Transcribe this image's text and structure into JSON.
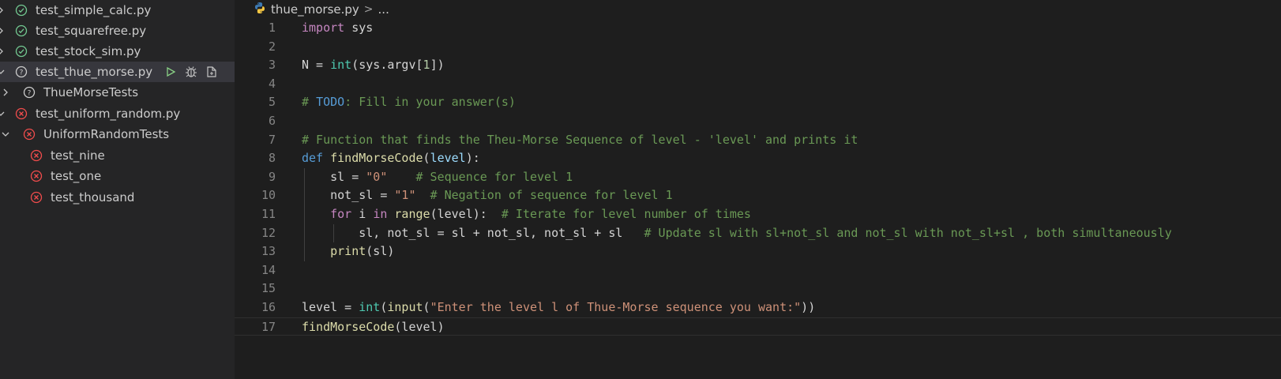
{
  "explorer": {
    "items": [
      {
        "label": "test_simple_calc.py",
        "status": "passed",
        "expanded": false
      },
      {
        "label": "test_squarefree.py",
        "status": "passed",
        "expanded": false
      },
      {
        "label": "test_stock_sim.py",
        "status": "passed",
        "expanded": false
      },
      {
        "label": "test_thue_morse.py",
        "status": "unknown",
        "expanded": true,
        "selected": true
      },
      {
        "label": "ThueMorseTests",
        "status": "unknown",
        "expanded": false
      },
      {
        "label": "test_uniform_random.py",
        "status": "failed",
        "expanded": true
      },
      {
        "label": "UniformRandomTests",
        "status": "failed",
        "expanded": true
      },
      {
        "label": "test_nine",
        "status": "failed"
      },
      {
        "label": "test_one",
        "status": "failed"
      },
      {
        "label": "test_thousand",
        "status": "failed"
      }
    ],
    "row_actions": [
      "run-icon",
      "debug-icon",
      "open-file-icon"
    ]
  },
  "editor": {
    "breadcrumb": {
      "file": "thue_morse.py",
      "separator": ">",
      "rest": "..."
    },
    "lines": [
      {
        "num": "1",
        "tokens": [
          [
            "kw",
            "import"
          ],
          [
            "p",
            " sys"
          ]
        ]
      },
      {
        "num": "2",
        "tokens": []
      },
      {
        "num": "3",
        "tokens": [
          [
            "p",
            "N = "
          ],
          [
            "ty",
            "int"
          ],
          [
            "p",
            "(sys.argv["
          ],
          [
            "nm",
            "1"
          ],
          [
            "p",
            "])"
          ]
        ]
      },
      {
        "num": "4",
        "tokens": []
      },
      {
        "num": "5",
        "tokens": [
          [
            "cm",
            "# "
          ],
          [
            "todo",
            "TODO"
          ],
          [
            "cm",
            ": Fill in your answer(s)"
          ]
        ]
      },
      {
        "num": "6",
        "tokens": []
      },
      {
        "num": "7",
        "tokens": [
          [
            "cm",
            "# Function that finds the Theu-Morse Sequence of level - 'level' and prints it"
          ]
        ]
      },
      {
        "num": "8",
        "tokens": [
          [
            "kwb",
            "def"
          ],
          [
            "p",
            " "
          ],
          [
            "fn",
            "findMorseCode"
          ],
          [
            "p",
            "("
          ],
          [
            "vr",
            "level"
          ],
          [
            "p",
            "):"
          ]
        ]
      },
      {
        "num": "9",
        "tokens": [
          [
            "p",
            "    sl = "
          ],
          [
            "st",
            "\"0\""
          ],
          [
            "p",
            "    "
          ],
          [
            "cm",
            "# Sequence for level 1"
          ]
        ]
      },
      {
        "num": "10",
        "tokens": [
          [
            "p",
            "    not_sl = "
          ],
          [
            "st",
            "\"1\""
          ],
          [
            "p",
            "  "
          ],
          [
            "cm",
            "# Negation of sequence for level 1"
          ]
        ]
      },
      {
        "num": "11",
        "tokens": [
          [
            "p",
            "    "
          ],
          [
            "kw",
            "for"
          ],
          [
            "p",
            " i "
          ],
          [
            "kw",
            "in"
          ],
          [
            "p",
            " "
          ],
          [
            "fn",
            "range"
          ],
          [
            "p",
            "(level):  "
          ],
          [
            "cm",
            "# Iterate for level number of times"
          ]
        ]
      },
      {
        "num": "12",
        "tokens": [
          [
            "p",
            "        sl, not_sl = sl + not_sl, not_sl + sl   "
          ],
          [
            "cm",
            "# Update sl with sl+not_sl and not_sl with not_sl+sl , both simultaneously"
          ]
        ]
      },
      {
        "num": "13",
        "tokens": [
          [
            "p",
            "    "
          ],
          [
            "fn",
            "print"
          ],
          [
            "p",
            "(sl)"
          ]
        ]
      },
      {
        "num": "14",
        "tokens": []
      },
      {
        "num": "15",
        "tokens": []
      },
      {
        "num": "16",
        "tokens": [
          [
            "p",
            "level = "
          ],
          [
            "ty",
            "int"
          ],
          [
            "p",
            "("
          ],
          [
            "fn",
            "input"
          ],
          [
            "p",
            "("
          ],
          [
            "st",
            "\"Enter the level l of Thue-Morse sequence you want:\""
          ],
          [
            "p",
            "))"
          ]
        ]
      },
      {
        "num": "17",
        "tokens": [
          [
            "fn",
            "findMorseCode"
          ],
          [
            "p",
            "(level)"
          ]
        ]
      }
    ]
  },
  "colors": {
    "passed": "#73c991",
    "failed": "#f14c4c",
    "unknown": "#cccccc",
    "run": "#89d185"
  }
}
